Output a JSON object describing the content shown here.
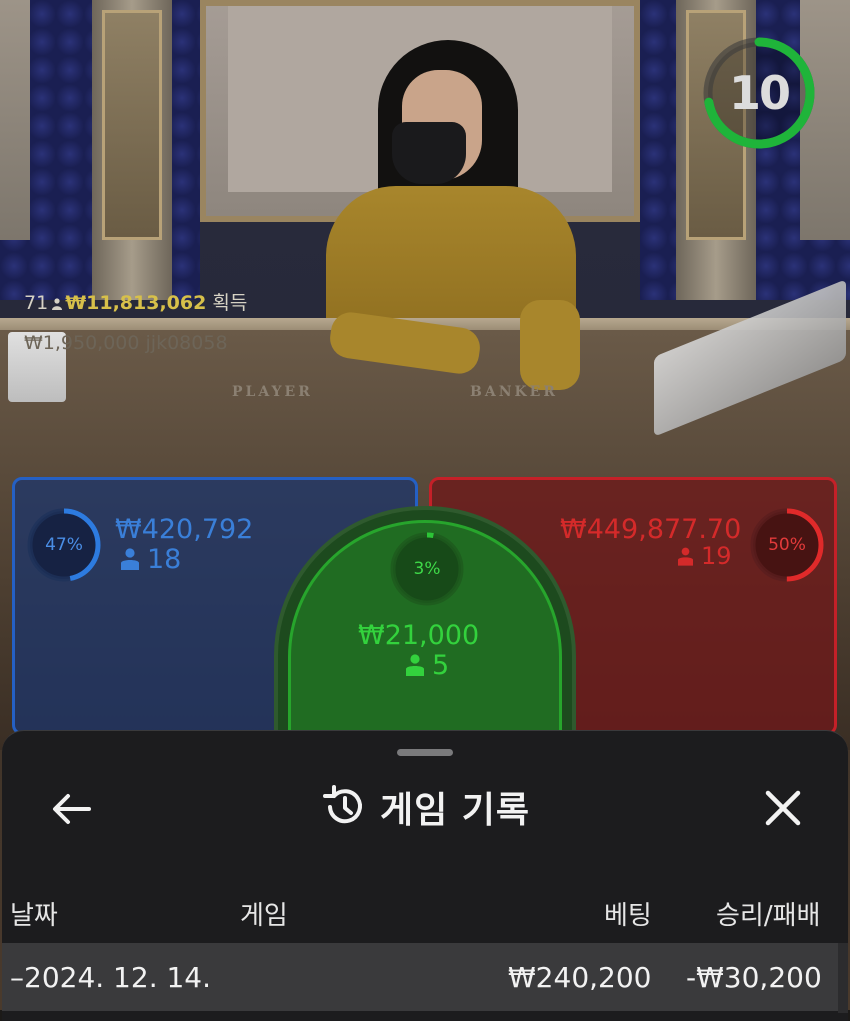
{
  "table": {
    "label_player": "PLAYER",
    "label_banker": "BANKER"
  },
  "winner": {
    "rank": "71",
    "amount": "₩11,813,062",
    "suffix": "획득"
  },
  "ticker": {
    "text": "₩1,950,000 jjk08058"
  },
  "timer": {
    "seconds": "10",
    "fraction_remaining": 0.72,
    "color": "#1fb43a"
  },
  "bets": {
    "player": {
      "percent": "47%",
      "fraction": 0.47,
      "amount": "₩420,792",
      "players": "18",
      "color": "#2d7be0"
    },
    "tie": {
      "percent": "3%",
      "fraction": 0.03,
      "amount": "₩21,000",
      "players": "5",
      "color": "#2cc436"
    },
    "banker": {
      "percent": "50%",
      "fraction": 0.5,
      "amount": "₩449,877.70",
      "players": "19",
      "color": "#e02a2a"
    }
  },
  "sheet": {
    "title": "게임 기록",
    "back_icon": "arrow-left-icon",
    "history_icon": "history-icon",
    "close_icon": "close-icon",
    "columns": {
      "date": "날짜",
      "game": "게임",
      "bet": "베팅",
      "win_loss": "승리/패배"
    },
    "rows": [
      {
        "date": "–2024. 12. 14.",
        "bet": "₩240,200",
        "win_loss": "-₩30,200"
      }
    ]
  }
}
